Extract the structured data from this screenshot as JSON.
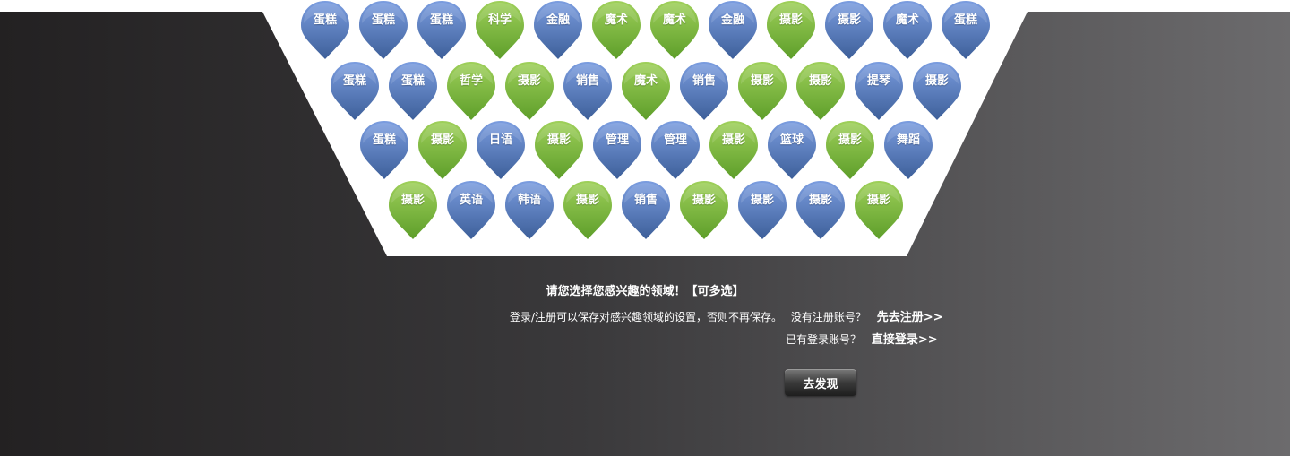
{
  "colors": {
    "blue_top": "#7b9de0",
    "blue_bottom": "#3d5f99",
    "green_top": "#9fd05a",
    "green_bottom": "#5e9e2a",
    "tray": "#ffffff"
  },
  "tags": [
    [
      {
        "label": "蛋糕",
        "color": "blue"
      },
      {
        "label": "蛋糕",
        "color": "blue"
      },
      {
        "label": "蛋糕",
        "color": "blue"
      },
      {
        "label": "科学",
        "color": "green"
      },
      {
        "label": "金融",
        "color": "blue"
      },
      {
        "label": "魔术",
        "color": "green"
      },
      {
        "label": "魔术",
        "color": "green"
      },
      {
        "label": "金融",
        "color": "blue"
      },
      {
        "label": "摄影",
        "color": "green"
      },
      {
        "label": "摄影",
        "color": "blue"
      },
      {
        "label": "魔术",
        "color": "blue"
      },
      {
        "label": "蛋糕",
        "color": "blue"
      }
    ],
    [
      {
        "label": "蛋糕",
        "color": "blue"
      },
      {
        "label": "蛋糕",
        "color": "blue"
      },
      {
        "label": "哲学",
        "color": "green"
      },
      {
        "label": "摄影",
        "color": "green"
      },
      {
        "label": "销售",
        "color": "blue"
      },
      {
        "label": "魔术",
        "color": "green"
      },
      {
        "label": "销售",
        "color": "blue"
      },
      {
        "label": "摄影",
        "color": "green"
      },
      {
        "label": "摄影",
        "color": "green"
      },
      {
        "label": "提琴",
        "color": "blue"
      },
      {
        "label": "摄影",
        "color": "blue"
      }
    ],
    [
      {
        "label": "蛋糕",
        "color": "blue"
      },
      {
        "label": "摄影",
        "color": "green"
      },
      {
        "label": "日语",
        "color": "blue"
      },
      {
        "label": "摄影",
        "color": "green"
      },
      {
        "label": "管理",
        "color": "blue"
      },
      {
        "label": "管理",
        "color": "blue"
      },
      {
        "label": "摄影",
        "color": "green"
      },
      {
        "label": "篮球",
        "color": "blue"
      },
      {
        "label": "摄影",
        "color": "green"
      },
      {
        "label": "舞蹈",
        "color": "blue"
      }
    ],
    [
      {
        "label": "摄影",
        "color": "green"
      },
      {
        "label": "英语",
        "color": "blue"
      },
      {
        "label": "韩语",
        "color": "blue"
      },
      {
        "label": "摄影",
        "color": "green"
      },
      {
        "label": "销售",
        "color": "blue"
      },
      {
        "label": "摄影",
        "color": "green"
      },
      {
        "label": "摄影",
        "color": "blue"
      },
      {
        "label": "摄影",
        "color": "blue"
      },
      {
        "label": "摄影",
        "color": "green"
      }
    ]
  ],
  "prompt": "请您选择您感兴趣的领域！【可多选】",
  "save_note": "登录/注册可以保存对感兴趣领域的设置，否则不再保存。",
  "no_account_question": "没有注册账号？",
  "register_link": "先去注册>>",
  "has_account_question": "已有登录账号？",
  "login_link": "直接登录>>",
  "discover_button": "去发现"
}
